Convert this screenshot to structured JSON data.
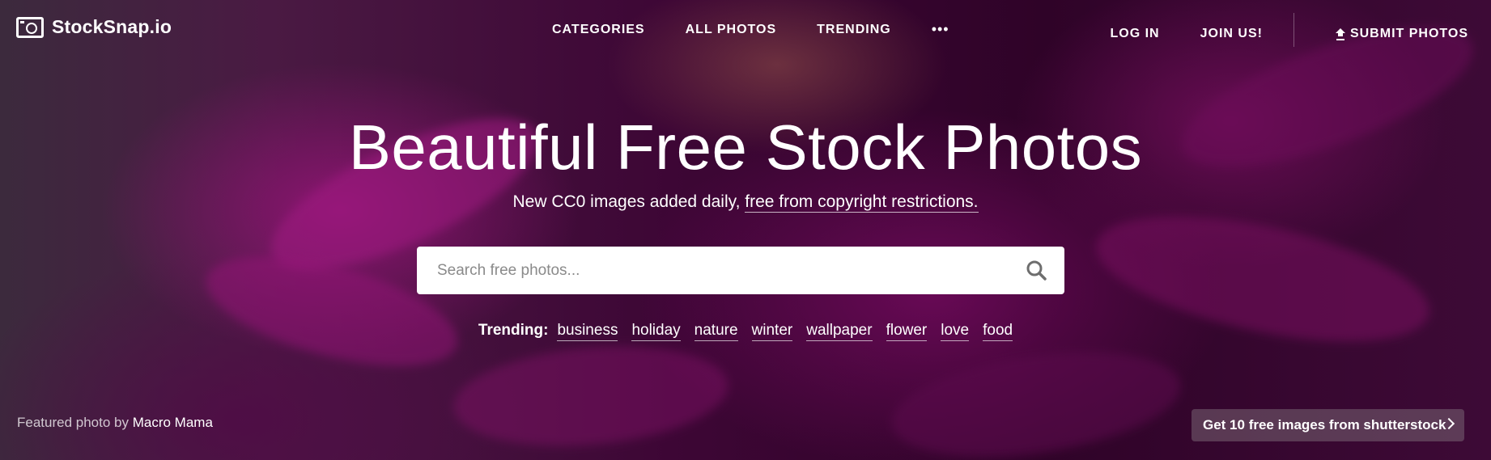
{
  "header": {
    "logo_text": "StockSnap.io",
    "nav": {
      "categories": "CATEGORIES",
      "all_photos": "ALL PHOTOS",
      "trending": "TRENDING",
      "more": "•••"
    },
    "log_in": "LOG IN",
    "join": "JOIN US!",
    "submit": "SUBMIT PHOTOS"
  },
  "hero": {
    "headline": "Beautiful Free Stock Photos",
    "subline_prefix": "New CC0 images added daily,",
    "subline_link": "free from copyright restrictions."
  },
  "search": {
    "placeholder": "Search free photos...",
    "value": ""
  },
  "trending": {
    "label": "Trending:",
    "tags": [
      "business",
      "holiday",
      "nature",
      "winter",
      "wallpaper",
      "flower",
      "love",
      "food"
    ]
  },
  "credit": {
    "prefix": "Featured photo by",
    "author": "Macro Mama"
  },
  "promo": {
    "label": "Get 10 free images from shutterstock"
  }
}
